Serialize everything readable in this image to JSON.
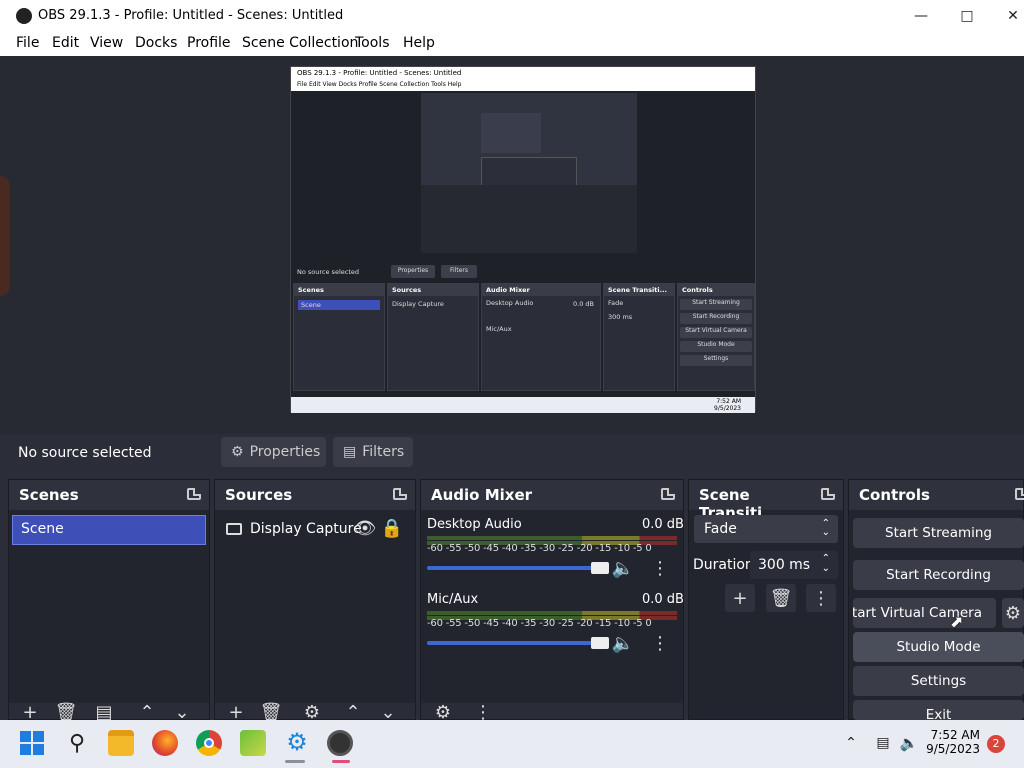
{
  "window": {
    "title": "OBS 29.1.3 - Profile: Untitled - Scenes: Untitled",
    "min_icon": "minimize-icon",
    "max_icon": "maximize-icon",
    "close_icon": "close-icon"
  },
  "menu": [
    "File",
    "Edit",
    "View",
    "Docks",
    "Profile",
    "Scene Collection",
    "Tools",
    "Help"
  ],
  "preview_shot": {
    "title": "OBS 29.1.3 - Profile: Untitled - Scenes: Untitled",
    "menu": "File   Edit   View   Docks   Profile   Scene Collection   Tools   Help",
    "no_source": "No source selected",
    "properties": "Properties",
    "filters": "Filters",
    "scenes": "Scenes",
    "scene_item": "Scene",
    "sources": "Sources",
    "source_item": "Display Capture",
    "audio_mixer": "Audio Mixer",
    "desktop_audio": "Desktop Audio",
    "mic_aux": "Mic/Aux",
    "db": "0.0 dB",
    "scene_transitions": "Scene Transiti...",
    "fade": "Fade",
    "duration": "Duration",
    "duration_val": "300 ms",
    "controls": "Controls",
    "ctrl": [
      "Start Streaming",
      "Start Recording",
      "Start Virtual Camera",
      "Studio Mode",
      "Settings",
      "Exit"
    ],
    "time": "7:52 AM",
    "date": "9/5/2023"
  },
  "source_bar": {
    "status": "No source selected",
    "properties": "Properties",
    "filters": "Filters"
  },
  "scenes": {
    "title": "Scenes",
    "items": [
      "Scene"
    ]
  },
  "sources": {
    "title": "Sources",
    "items": [
      {
        "name": "Display Capture",
        "icon": "monitor-icon"
      }
    ]
  },
  "mixer": {
    "title": "Audio Mixer",
    "channels": [
      {
        "name": "Desktop Audio",
        "db": "0.0 dB",
        "ticks": "-60 -55 -50 -45 -40 -35 -30 -25 -20 -15 -10  -5  0",
        "volume": 1.0
      },
      {
        "name": "Mic/Aux",
        "db": "0.0 dB",
        "ticks": "-60 -55 -50 -45 -40 -35 -30 -25 -20 -15 -10  -5  0",
        "volume": 1.0
      }
    ]
  },
  "transitions": {
    "title": "Scene Transiti...",
    "selected": "Fade",
    "duration_label": "Duration",
    "duration_value": "300 ms"
  },
  "controls": {
    "title": "Controls",
    "buttons": [
      "Start Streaming",
      "Start Recording",
      "Start Virtual Camera",
      "Studio Mode",
      "Settings",
      "Exit"
    ]
  },
  "taskbar": {
    "time": "7:52 AM",
    "date": "9/5/2023",
    "notifications": "2"
  },
  "colors": {
    "accent": "#3f4fb8",
    "slider": "#3c68d6",
    "panel": "#22252e"
  }
}
